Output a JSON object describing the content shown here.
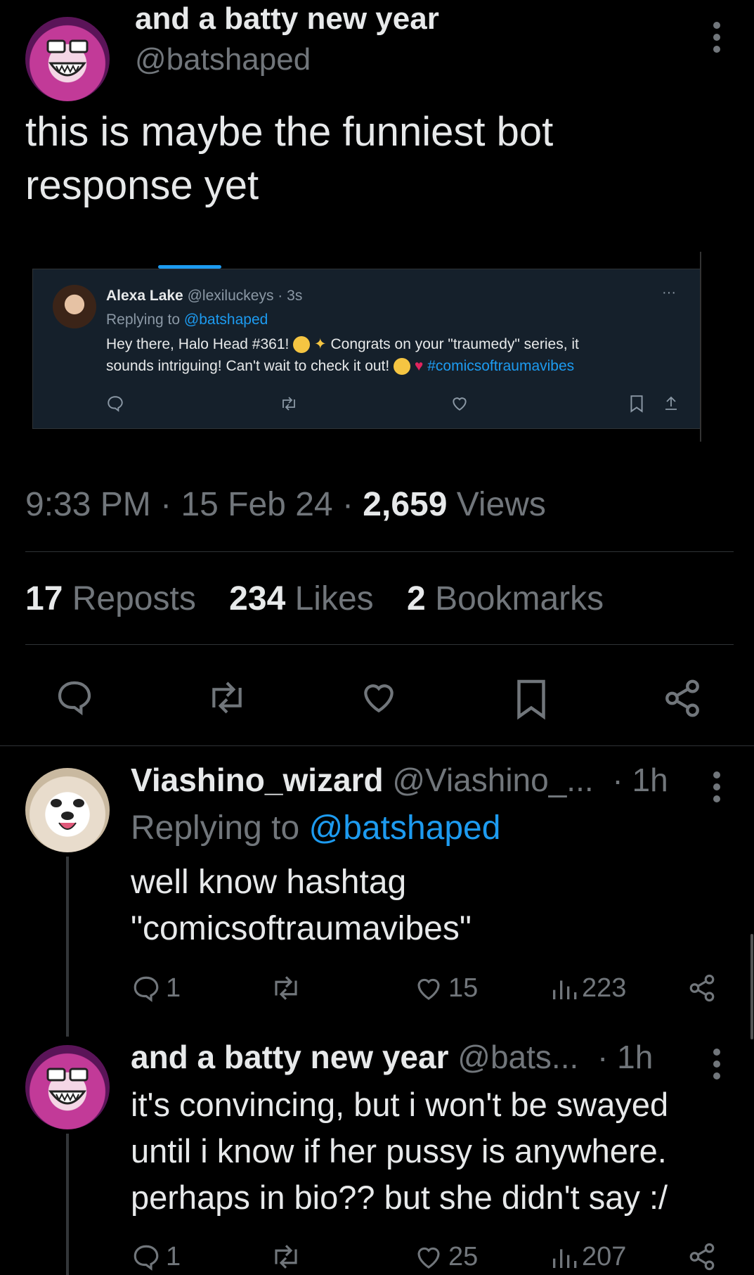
{
  "main_tweet": {
    "display_name": "and a batty new year",
    "handle": "@batshaped",
    "text_line1": "this is maybe the funniest bot",
    "text_line2": "response yet",
    "time": "9:33 PM",
    "date": "15 Feb 24",
    "views_count": "2,659",
    "views_label": "Views",
    "reposts_count": "17",
    "reposts_label": "Reposts",
    "likes_count": "234",
    "likes_label": "Likes",
    "bookmarks_count": "2",
    "bookmarks_label": "Bookmarks"
  },
  "embedded": {
    "name": "Alexa Lake",
    "handle": "@lexiluckeys",
    "time": "3s",
    "replying_prefix": "Replying to",
    "replying_handle": "@batshaped",
    "text1": "Hey there, Halo Head #361!",
    "text2": "Congrats on your \"traumedy\" series, it",
    "text3": "sounds intriguing! Can't wait to check it out!",
    "hashtag": "#comicsoftraumavibes",
    "more": "···"
  },
  "reply1": {
    "display_name": "Viashino_wizard",
    "handle": "@Viashino_...",
    "time": "1h",
    "replying_prefix": "Replying to",
    "replying_handle": "@batshaped",
    "text_line1": "well know hashtag",
    "text_line2": "\"comicsoftraumavibes\"",
    "replies": "1",
    "likes": "15",
    "views": "223"
  },
  "reply2": {
    "display_name": "and a batty new year",
    "handle": "@bats...",
    "time": "1h",
    "text_line1": "it's convincing, but i won't be swayed",
    "text_line2": "until i know if her pussy is anywhere.",
    "text_line3": "perhaps in bio?? but she didn't say :/",
    "replies": "1",
    "likes": "25",
    "views": "207"
  },
  "colors": {
    "background": "#000000",
    "text": "#e7e9ea",
    "muted": "#71767b",
    "link": "#1d9bf0",
    "avatar_bat": "#a0207a",
    "embedded_bg": "#15202b"
  }
}
